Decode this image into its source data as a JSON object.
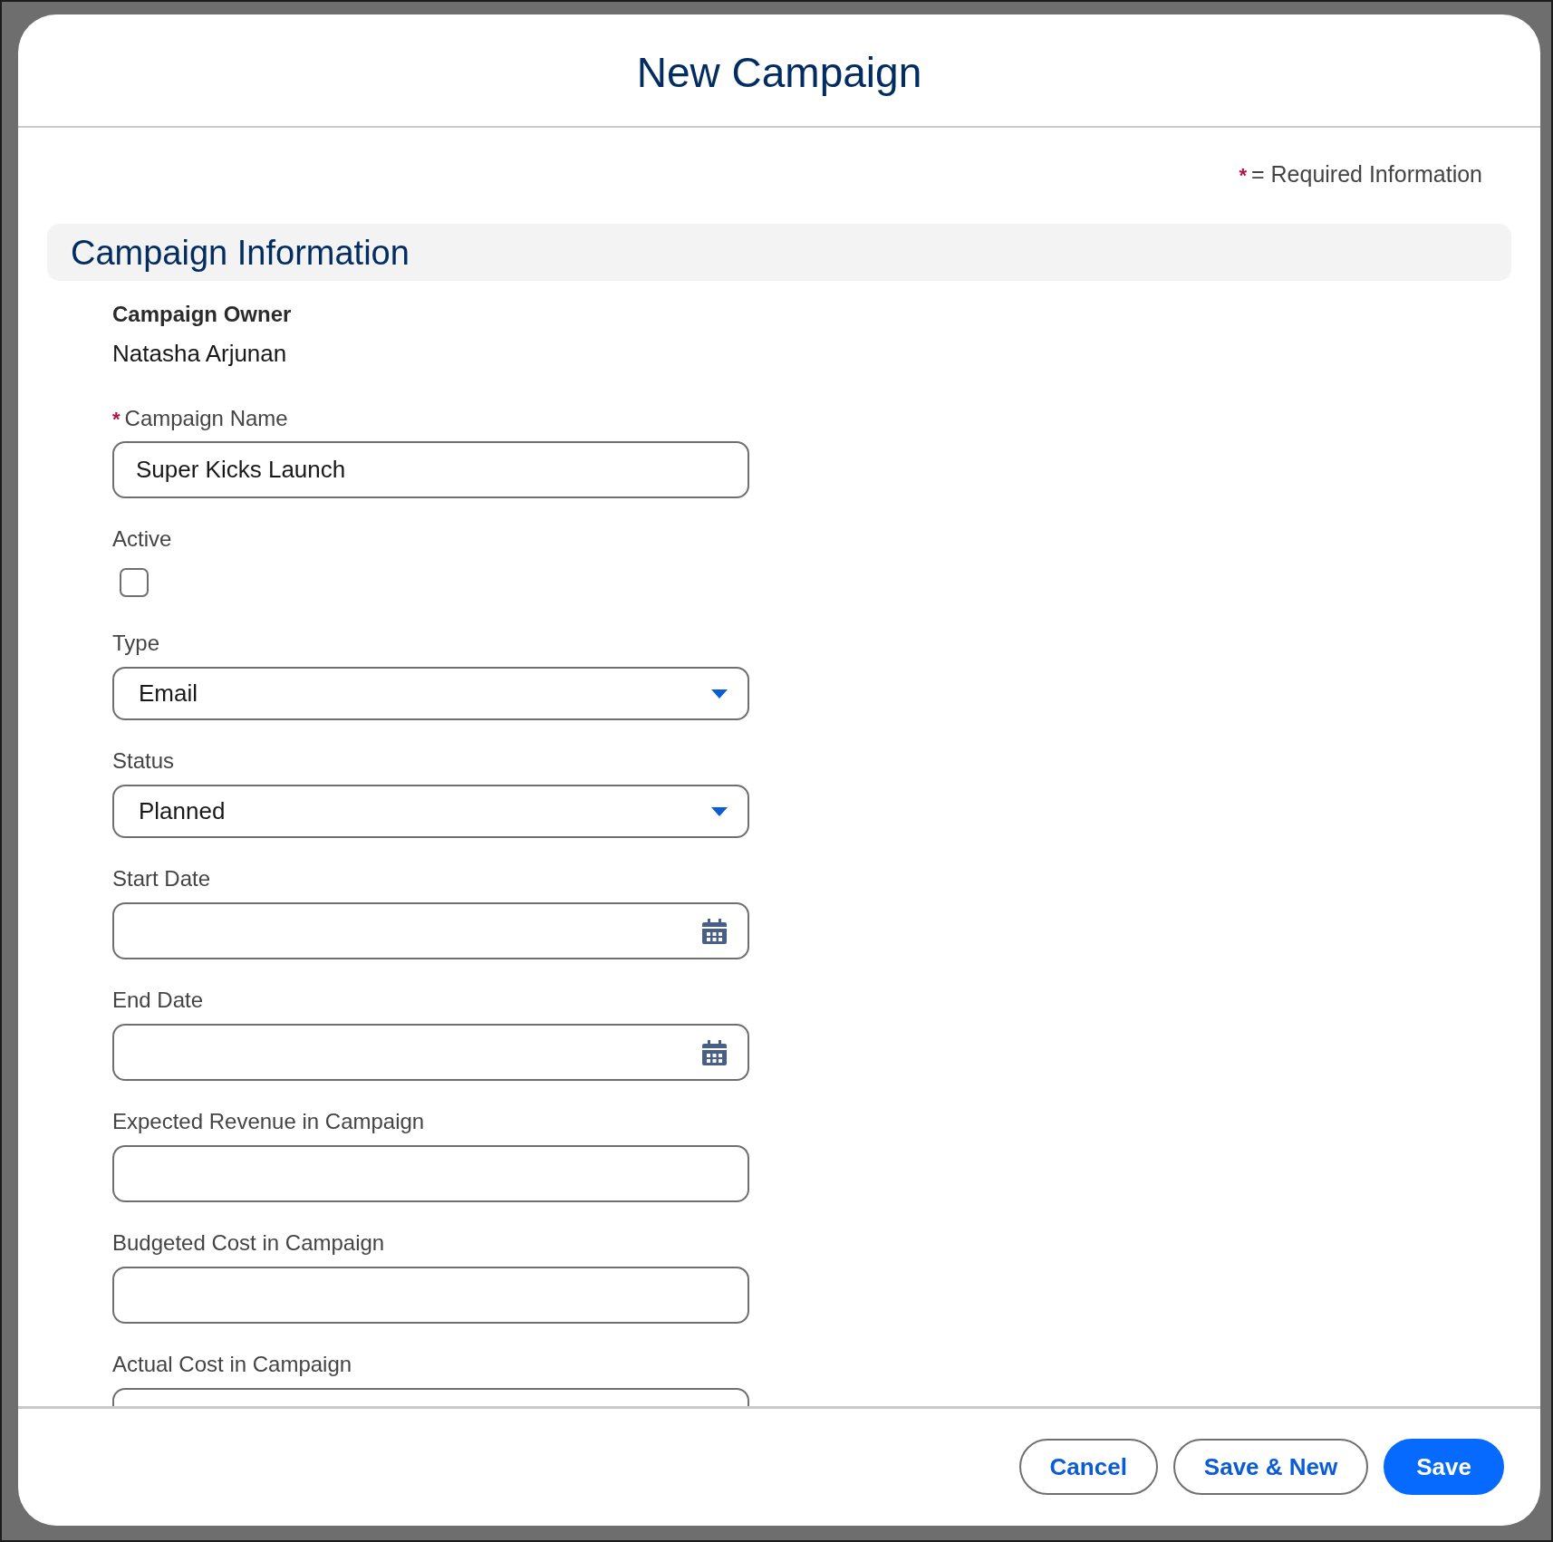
{
  "modal": {
    "title": "New Campaign"
  },
  "required_note": {
    "marker": "*",
    "text": "= Required Information"
  },
  "section": {
    "title": "Campaign Information",
    "fields": [
      {
        "kind": "readonly",
        "label": "Campaign Owner",
        "value": "Natasha Arjunan"
      },
      {
        "kind": "text",
        "label": "Campaign Name",
        "required_mark": "*",
        "value": "Super Kicks Launch"
      },
      {
        "kind": "checkbox",
        "label": "Active",
        "checked": false
      },
      {
        "kind": "select",
        "label": "Type",
        "value": "Email"
      },
      {
        "kind": "select",
        "label": "Status",
        "value": "Planned"
      },
      {
        "kind": "date",
        "label": "Start Date"
      },
      {
        "kind": "date",
        "label": "End Date"
      },
      {
        "kind": "text",
        "label": "Expected Revenue in Campaign"
      },
      {
        "kind": "text",
        "label": "Budgeted Cost in Campaign"
      },
      {
        "kind": "text",
        "label": "Actual Cost in Campaign"
      }
    ]
  },
  "footer": {
    "buttons": [
      {
        "label": "Cancel",
        "kind": "neutral"
      },
      {
        "label": "Save & New",
        "kind": "neutral"
      },
      {
        "label": "Save",
        "kind": "brand"
      }
    ]
  }
}
